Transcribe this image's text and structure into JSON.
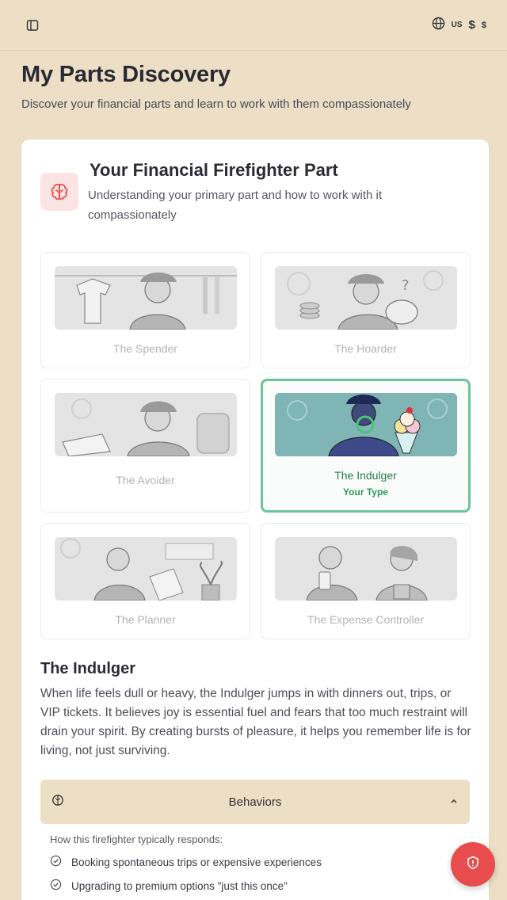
{
  "topbar": {
    "locale_label": "US",
    "currency_symbol": "$",
    "currency_symbol_small": "$"
  },
  "page": {
    "title": "My Parts Discovery",
    "subtitle": "Discover your financial parts and learn to work with them compassionately"
  },
  "card": {
    "title": "Your Financial Firefighter Part",
    "description": "Understanding your primary part and how to work with it compassionately",
    "accent_color": "#e94c4c"
  },
  "parts": [
    {
      "label": "The Spender"
    },
    {
      "label": "The Hoarder"
    },
    {
      "label": "The Avoider"
    },
    {
      "label": "The Indulger",
      "badge": "Your Type"
    },
    {
      "label": "The Planner"
    },
    {
      "label": "The Expense Controller"
    }
  ],
  "selected_color": "#6cc59a",
  "detail": {
    "title": "The Indulger",
    "text": "When life feels dull or heavy, the Indulger jumps in with dinners out, trips, or VIP tickets. It believes joy is essential fuel and fears that too much restraint will drain your spirit. By creating bursts of pleasure, it helps you remember life is for living, not just surviving."
  },
  "behaviors": {
    "label": "Behaviors",
    "intro": "How this firefighter typically responds:",
    "items": [
      "Booking spontaneous trips or expensive experiences",
      "Upgrading to premium options \"just this once\""
    ]
  }
}
